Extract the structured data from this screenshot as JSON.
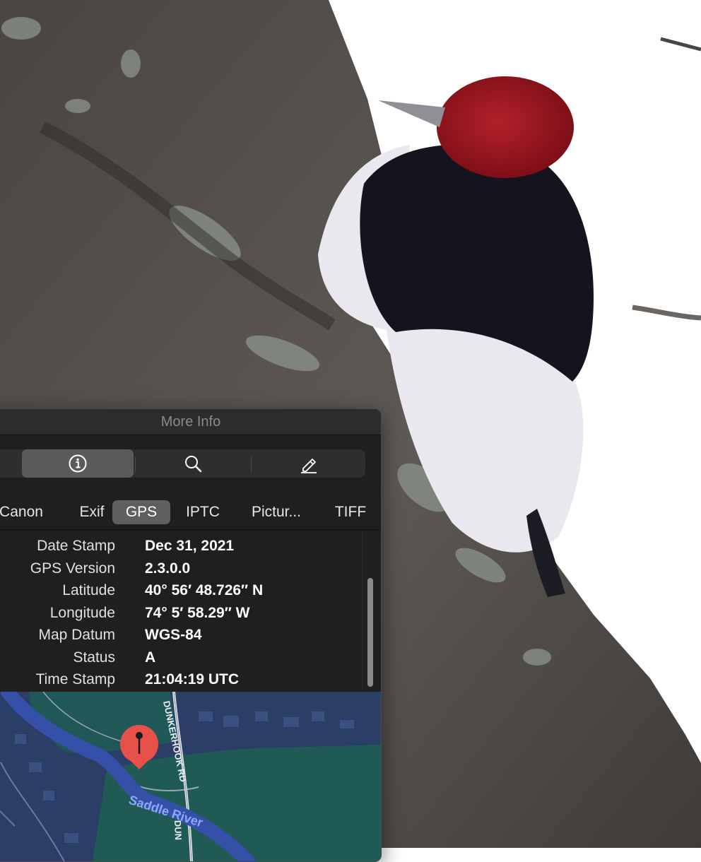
{
  "window": {
    "title": "More Info"
  },
  "toolbar": {
    "buttons": [
      {
        "name": "info",
        "icon": "info-icon",
        "selected": true
      },
      {
        "name": "search",
        "icon": "magnifier-icon",
        "selected": false
      },
      {
        "name": "edit",
        "icon": "pencil-icon",
        "selected": false
      }
    ]
  },
  "tabs": [
    {
      "label": "Canon"
    },
    {
      "label": "Exif"
    },
    {
      "label": "GPS",
      "selected": true
    },
    {
      "label": "IPTC"
    },
    {
      "label": "Pictur..."
    },
    {
      "label": "TIFF"
    }
  ],
  "gps": {
    "rows": [
      {
        "label": "Date Stamp",
        "value": "Dec 31, 2021"
      },
      {
        "label": "GPS Version",
        "value": "2.3.0.0"
      },
      {
        "label": "Latitude",
        "value": "40° 56′ 48.726″ N"
      },
      {
        "label": "Longitude",
        "value": "74° 5′ 58.29″ W"
      },
      {
        "label": "Map Datum",
        "value": "WGS-84"
      },
      {
        "label": "Status",
        "value": "A"
      },
      {
        "label": "Time Stamp",
        "value": "21:04:19 UTC"
      }
    ]
  },
  "map": {
    "road_label_1": "DUNKERHOOK RD",
    "road_label_2": "DUN",
    "river_label": "Saddle River",
    "pin_color": "#e8514a"
  },
  "colors": {
    "panel_bg": "#1f1f1f",
    "selected_bg": "#5f5f5f",
    "map_green": "#1f5a55",
    "map_blue": "#2a3e66",
    "river": "#3550a8",
    "bird_red": "#a0111c"
  }
}
